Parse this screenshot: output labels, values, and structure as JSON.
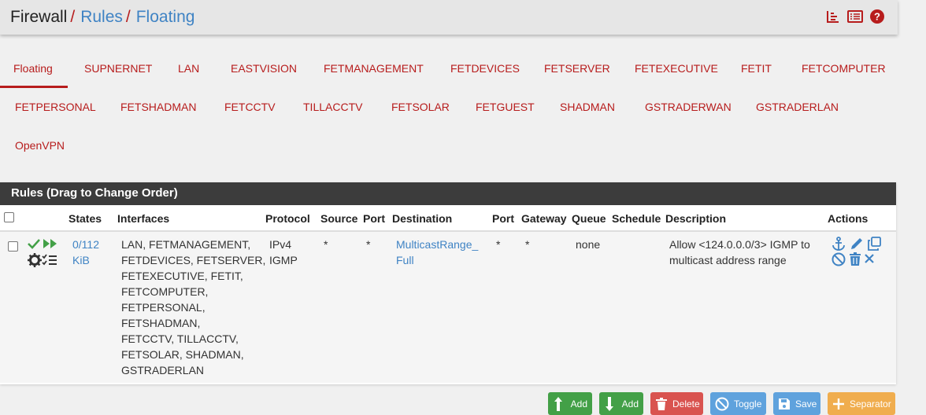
{
  "breadcrumb": {
    "root": "Firewall",
    "sep": "/",
    "rules": "Rules",
    "current": "Floating"
  },
  "header_icons": [
    "chart-icon",
    "list-icon",
    "help-icon"
  ],
  "tabs": [
    [
      "Floating",
      "SUPNERNET",
      "LAN",
      "EASTVISION",
      "FETMANAGEMENT",
      "FETDEVICES",
      "FETSERVER",
      "FETEXECUTIVE",
      "FETIT",
      "FETCOMPUTER"
    ],
    [
      "FETPERSONAL",
      "FETSHADMAN",
      "FETCCTV",
      "TILLACCTV",
      "FETSOLAR",
      "FETGUEST",
      "SHADMAN",
      "GSTRADERWAN",
      "GSTRADERLAN"
    ],
    [
      "OpenVPN"
    ]
  ],
  "active_tab": "Floating",
  "panel": {
    "title": "Rules (Drag to Change Order)"
  },
  "columns": [
    "States",
    "Interfaces",
    "Protocol",
    "Source",
    "Port",
    "Destination",
    "Port",
    "Gateway",
    "Queue",
    "Schedule",
    "Description",
    "Actions"
  ],
  "rule": {
    "states": [
      "0/112",
      "KiB"
    ],
    "interfaces": [
      "LAN, FETMANAGEMENT,",
      "FETDEVICES, FETSERVER,",
      "FETEXECUTIVE, FETIT,",
      "FETCOMPUTER,",
      "FETPERSONAL,",
      "FETSHADMAN,",
      "FETCCTV, TILLACCTV,",
      "FETSOLAR, SHADMAN,",
      "GSTRADERLAN"
    ],
    "protocol": [
      "IPv4",
      "IGMP"
    ],
    "source": "*",
    "source_port": "*",
    "destination": [
      "MulticastRange_",
      "Full"
    ],
    "dest_port": "*",
    "gateway": "*",
    "queue": "none",
    "schedule": "",
    "description": [
      "Allow <124.0.0.0/3> IGMP to",
      "multicast address range"
    ]
  },
  "buttons": {
    "add_top": "Add",
    "add_bottom": "Add",
    "delete": "Delete",
    "toggle": "Toggle",
    "save": "Save",
    "separator": "Separator"
  },
  "colors": {
    "accent": "#b71c1c",
    "link": "#3f83c4",
    "green": "#43a047",
    "red": "#d9534f",
    "blue": "#5fa2dd",
    "orange": "#f0ad4e",
    "panel_head": "#3c3c3c"
  }
}
